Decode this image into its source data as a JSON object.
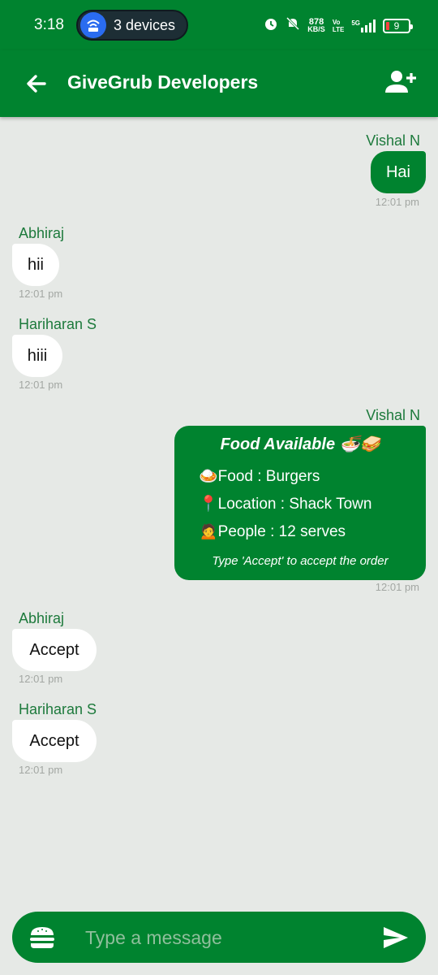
{
  "status_bar": {
    "time": "3:18",
    "hotspot_label": "3 devices",
    "net_speed_value": "878",
    "net_speed_unit": "KB/S",
    "volte_top": "Vo",
    "volte_bottom": "LTE",
    "network": "5G",
    "battery": "9"
  },
  "header": {
    "title": "GiveGrub Developers",
    "back_icon": "arrow-left-icon",
    "action_icon": "person-add-icon"
  },
  "messages": [
    {
      "sender": "Vishal N",
      "text": "Hai",
      "time": "12:01 pm",
      "outgoing": true
    },
    {
      "sender": "Abhiraj",
      "text": "hii",
      "time": "12:01 pm",
      "outgoing": false
    },
    {
      "sender": "Hariharan S",
      "text": "hiii",
      "time": "12:01 pm",
      "outgoing": false
    },
    {
      "sender": "Vishal N",
      "time": "12:01 pm",
      "outgoing": true
    },
    {
      "sender": "Abhiraj",
      "text": "Accept",
      "time": "12:01 pm",
      "outgoing": false
    },
    {
      "sender": "Hariharan S",
      "text": "Accept",
      "time": "12:01 pm",
      "outgoing": false
    }
  ],
  "food_card": {
    "title": "Food Available 🍜🥪",
    "food": "🍛Food : Burgers",
    "location": "📍Location : Shack Town",
    "people": "🙍People : 12 serves",
    "hint": "Type 'Accept' to accept the order"
  },
  "composer": {
    "placeholder": "Type a message",
    "left_icon": "burger-icon",
    "send_icon": "send-icon"
  },
  "colors": {
    "primary": "#00832f",
    "background": "#e6e9e6",
    "sender_name": "#1d7a3c",
    "timestamp": "#a3a7a3"
  }
}
